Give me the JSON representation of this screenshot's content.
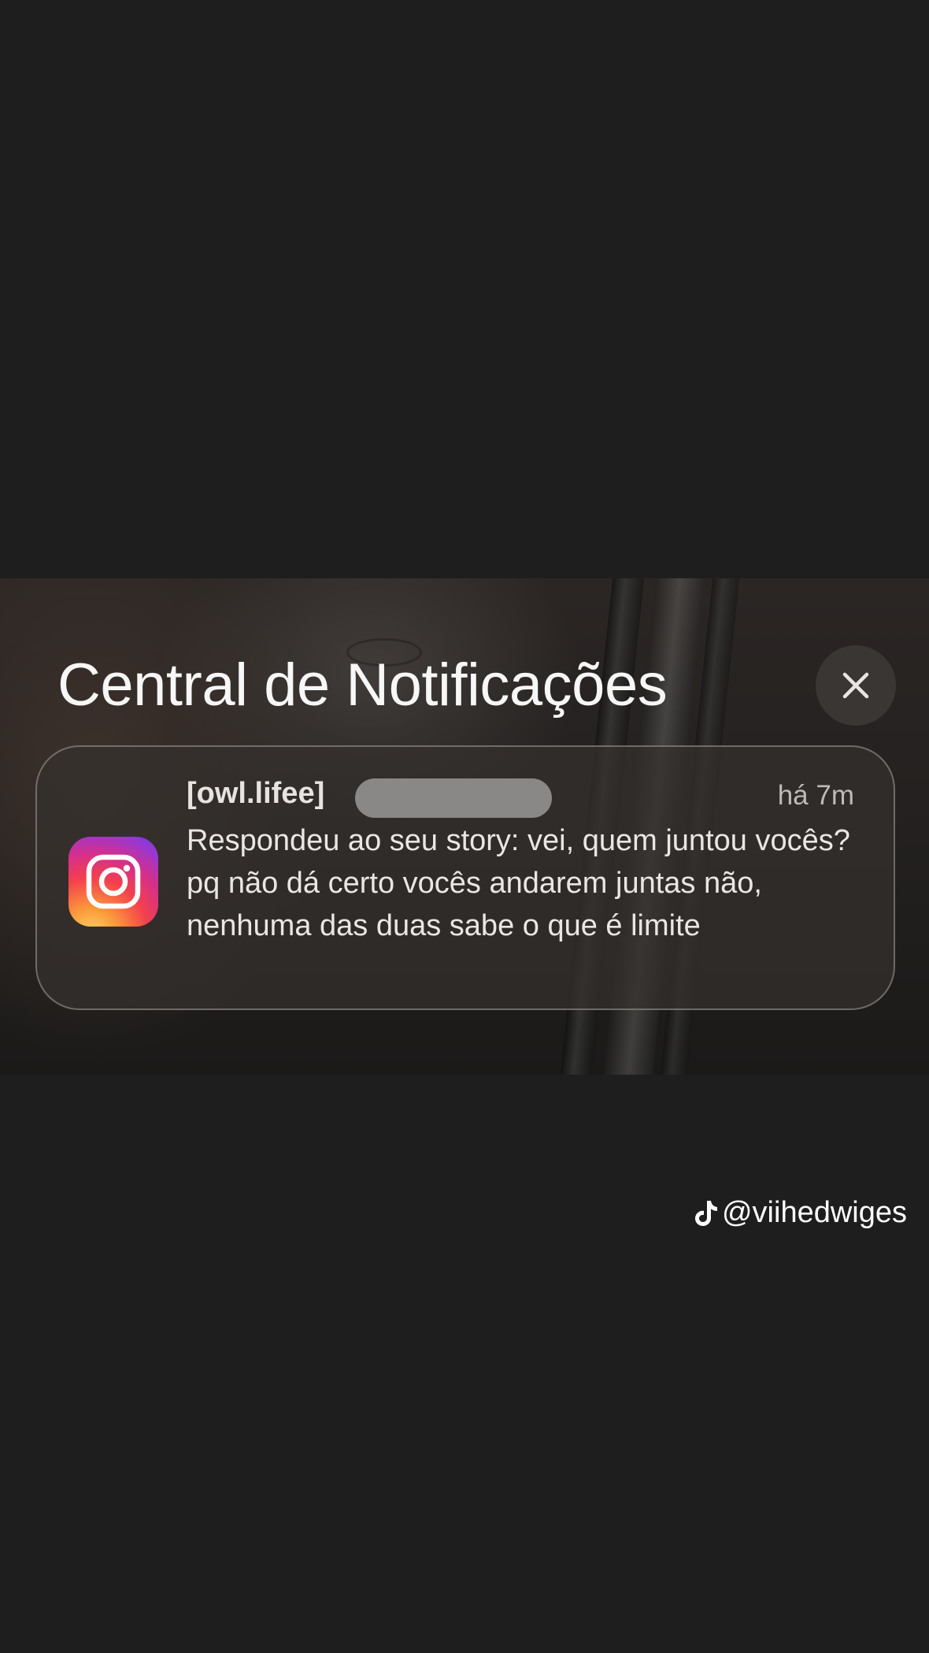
{
  "notification_center": {
    "title": "Central de Notificações",
    "close_icon": "close-icon"
  },
  "notification": {
    "app_icon": "instagram-icon",
    "sender": "[owl.lifee]",
    "time": "há 7m",
    "message": "Respondeu ao seu story: vei, quem juntou vocês? pq não dá certo vocês andarem juntas não, nenhuma das duas sabe o que é limite"
  },
  "watermark": {
    "icon": "tiktok-icon",
    "handle": "@viihedwiges"
  },
  "colors": {
    "page_background": "#1e1e1e",
    "text_primary": "#f7f7f7",
    "text_secondary": "#bdbab7"
  }
}
